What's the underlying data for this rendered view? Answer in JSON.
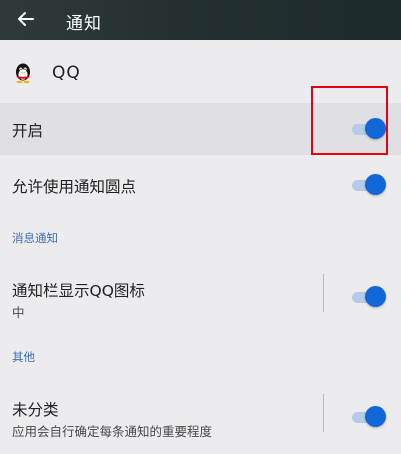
{
  "header": {
    "title": "通知",
    "back_icon": "arrow-left-icon"
  },
  "app": {
    "name": "QQ",
    "icon": "qq-penguin-icon"
  },
  "settings": {
    "enable": {
      "label": "开启",
      "on": true
    },
    "dots": {
      "label": "允许使用通知圆点",
      "on": true
    }
  },
  "sections": {
    "message": {
      "title": "消息通知",
      "item": {
        "label": "通知栏显示QQ图标",
        "sub": "中",
        "on": true
      }
    },
    "other": {
      "title": "其他",
      "item": {
        "label": "未分类",
        "sub": "应用会自行确定每条通知的重要程度",
        "on": true
      }
    }
  },
  "colors": {
    "accent": "#1167d6",
    "annotation": "#e60012"
  }
}
